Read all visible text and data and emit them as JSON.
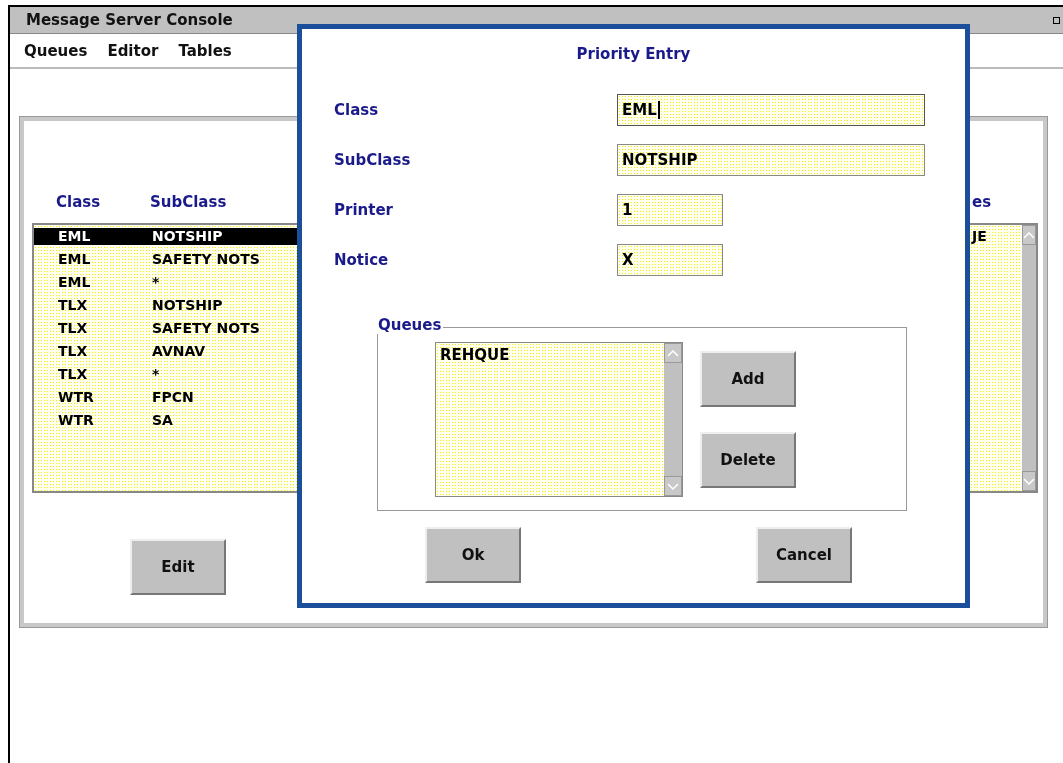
{
  "window": {
    "title": "Message Server Console"
  },
  "menu": [
    {
      "label": "Queues"
    },
    {
      "label": "Editor"
    },
    {
      "label": "Tables"
    }
  ],
  "table": {
    "columns": [
      "Class",
      "SubClass",
      "es"
    ],
    "rows": [
      {
        "class": "EML",
        "subclass": "NOTSHIP",
        "column_3": "JE",
        "selected": true
      },
      {
        "class": "EML",
        "subclass": "SAFETY NOTS",
        "selected": false
      },
      {
        "class": "EML",
        "subclass": "*",
        "selected": false
      },
      {
        "class": "TLX",
        "subclass": "NOTSHIP",
        "selected": false
      },
      {
        "class": "TLX",
        "subclass": "SAFETY NOTS",
        "selected": false
      },
      {
        "class": "TLX",
        "subclass": "AVNAV",
        "selected": false
      },
      {
        "class": "TLX",
        "subclass": "*",
        "selected": false
      },
      {
        "class": "WTR",
        "subclass": "FPCN",
        "selected": false
      },
      {
        "class": "WTR",
        "subclass": "SA",
        "selected": false
      }
    ]
  },
  "edit_button": "Edit",
  "dialog": {
    "title": "Priority Entry",
    "fields": [
      {
        "label": "Class",
        "value": "EML",
        "focused": true,
        "kind": "text"
      },
      {
        "label": "SubClass",
        "value": "NOTSHIP",
        "focused": false,
        "kind": "text"
      },
      {
        "label": "Printer",
        "value": "1",
        "focused": false,
        "kind": "flag"
      },
      {
        "label": "Notice",
        "value": "X",
        "focused": false,
        "kind": "flag"
      }
    ],
    "queues": {
      "legend": "Queues",
      "items": [
        "REHQUE"
      ],
      "buttons": [
        "Add",
        "Delete"
      ]
    },
    "buttons": [
      "Ok",
      "Cancel"
    ]
  }
}
